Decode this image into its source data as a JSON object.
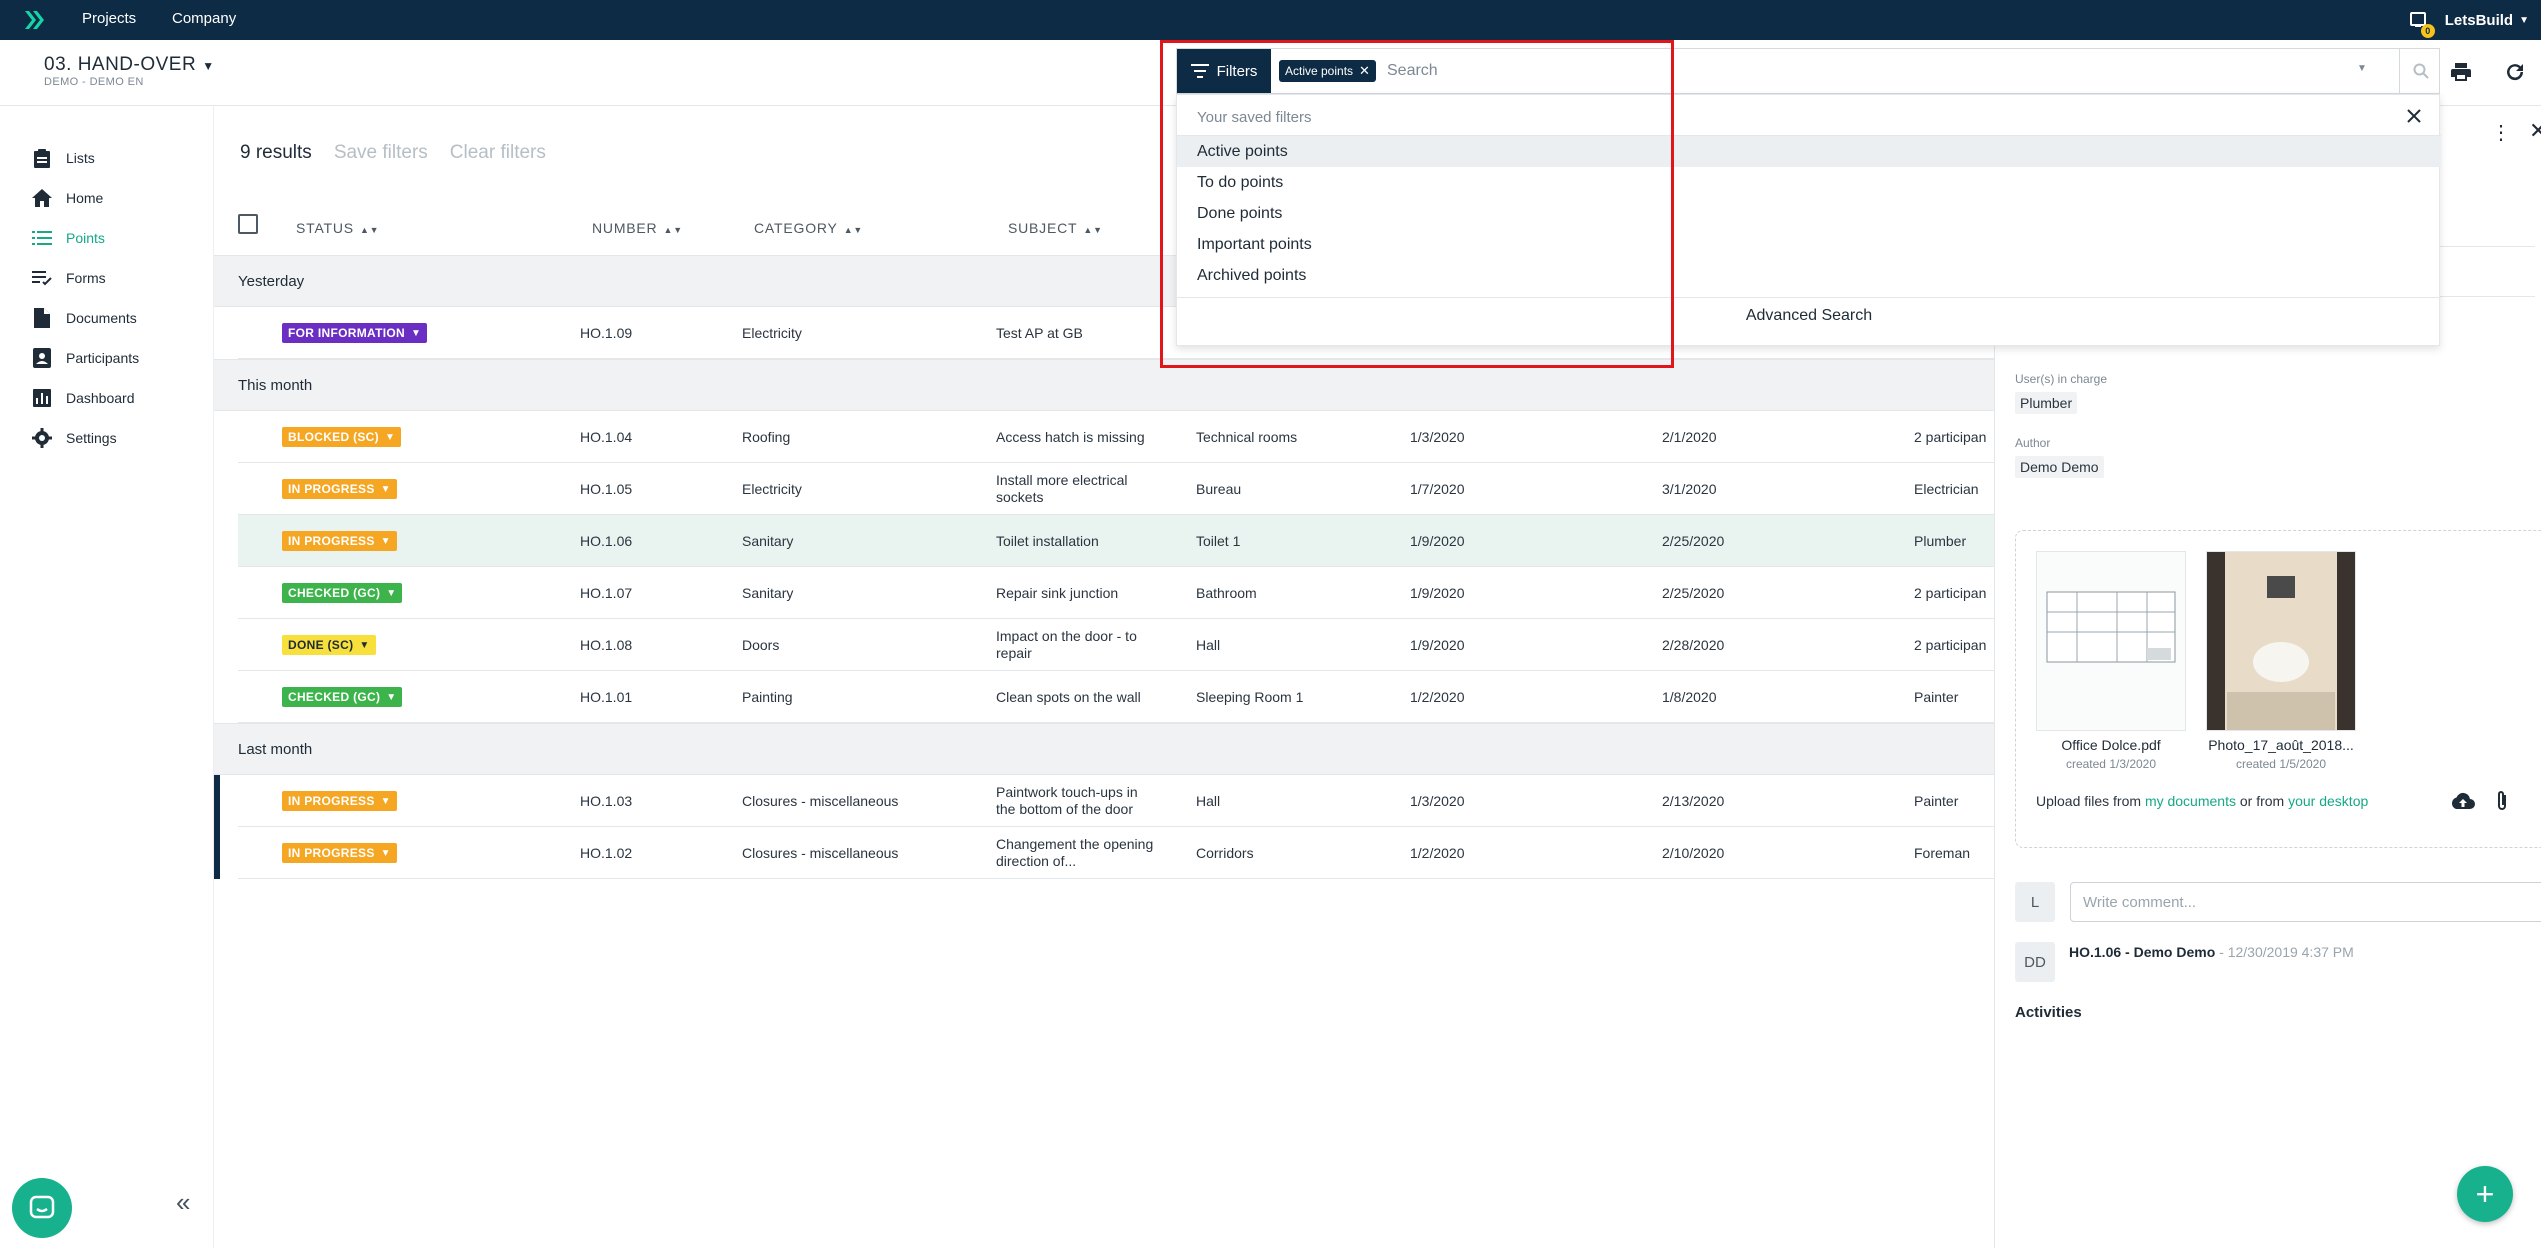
{
  "topbar": {
    "nav": [
      "Projects",
      "Company"
    ],
    "user": "LetsBuild",
    "notification_count": "0"
  },
  "project": {
    "title": "03. HAND-OVER",
    "subtitle": "DEMO - DEMO EN"
  },
  "sidebar": {
    "items": [
      {
        "label": "Lists",
        "icon": "clipboard-icon"
      },
      {
        "label": "Home",
        "icon": "home-icon"
      },
      {
        "label": "Points",
        "icon": "list-icon"
      },
      {
        "label": "Forms",
        "icon": "forms-icon"
      },
      {
        "label": "Documents",
        "icon": "document-icon"
      },
      {
        "label": "Participants",
        "icon": "participants-icon"
      },
      {
        "label": "Dashboard",
        "icon": "dashboard-icon"
      },
      {
        "label": "Settings",
        "icon": "gear-icon"
      }
    ],
    "active": "Points"
  },
  "toolbar": {
    "results": "9 results",
    "save_filters": "Save filters",
    "clear_filters": "Clear filters"
  },
  "table": {
    "headers": [
      "STATUS",
      "NUMBER",
      "CATEGORY",
      "SUBJECT"
    ],
    "groups": [
      {
        "label": "Yesterday",
        "rows": [
          {
            "status": "FOR INFORMATION",
            "color": "#6a2fc2",
            "number": "HO.1.09",
            "category": "Electricity",
            "subject": "Test AP at GB",
            "location": "",
            "created": "",
            "due": "",
            "assignee": ""
          }
        ]
      },
      {
        "label": "This month",
        "rows": [
          {
            "status": "BLOCKED (SC)",
            "color": "#f5a623",
            "number": "HO.1.04",
            "category": "Roofing",
            "subject": "Access hatch is missing",
            "location": "Technical rooms",
            "created": "1/3/2020",
            "due": "2/1/2020",
            "assignee": "2 participan"
          },
          {
            "status": "IN PROGRESS",
            "color": "#f5a623",
            "number": "HO.1.05",
            "category": "Electricity",
            "subject": "Install more electrical sockets",
            "location": "Bureau",
            "created": "1/7/2020",
            "due": "3/1/2020",
            "assignee": "Electrician"
          },
          {
            "status": "IN PROGRESS",
            "color": "#f5a623",
            "number": "HO.1.06",
            "category": "Sanitary",
            "subject": "Toilet installation",
            "location": "Toilet 1",
            "created": "1/9/2020",
            "due": "2/25/2020",
            "assignee": "Plumber",
            "selected": true
          },
          {
            "status": "CHECKED (GC)",
            "color": "#3cb44b",
            "number": "HO.1.07",
            "category": "Sanitary",
            "subject": "Repair sink junction",
            "location": "Bathroom",
            "created": "1/9/2020",
            "due": "2/25/2020",
            "assignee": "2 participan"
          },
          {
            "status": "DONE (SC)",
            "color": "#f7e03c",
            "textColor": "#1f2b36",
            "number": "HO.1.08",
            "category": "Doors",
            "subject": "Impact on the door - to repair",
            "location": "Hall",
            "created": "1/9/2020",
            "due": "2/28/2020",
            "assignee": "2 participan"
          },
          {
            "status": "CHECKED (GC)",
            "color": "#3cb44b",
            "number": "HO.1.01",
            "category": "Painting",
            "subject": "Clean spots on the wall",
            "location": "Sleeping Room 1",
            "created": "1/2/2020",
            "due": "1/8/2020",
            "assignee": "Painter"
          }
        ]
      },
      {
        "label": "Last month",
        "rows": [
          {
            "status": "IN PROGRESS",
            "color": "#f5a623",
            "number": "HO.1.03",
            "category": "Closures - miscellaneous",
            "subject": "Paintwork touch-ups in the bottom of the door",
            "location": "Hall",
            "created": "1/3/2020",
            "due": "2/13/2020",
            "assignee": "Painter",
            "flag": true
          },
          {
            "status": "IN PROGRESS",
            "color": "#f5a623",
            "number": "HO.1.02",
            "category": "Closures - miscellaneous",
            "subject": "Changement the opening direction of...",
            "location": "Corridors",
            "created": "1/2/2020",
            "due": "2/10/2020",
            "assignee": "Foreman",
            "flag": true
          }
        ]
      }
    ]
  },
  "search": {
    "filters_label": "Filters",
    "active_chip": "Active points",
    "placeholder": "Search"
  },
  "dropdown": {
    "header": "Your saved filters",
    "items": [
      "Active points",
      "To do points",
      "Done points",
      "Important points",
      "Archived points"
    ],
    "highlighted": "Active points",
    "advanced": "Advanced Search"
  },
  "detail": {
    "users_label": "User(s) in charge",
    "users_value": "Plumber",
    "author_label": "Author",
    "author_value": "Demo Demo",
    "files": [
      {
        "name": "Office Dolce.pdf",
        "date": "created 1/3/2020"
      },
      {
        "name": "Photo_17_août_2018...",
        "date": "created 1/5/2020"
      }
    ],
    "upload_prefix": "Upload files from",
    "upload_link1": "my documents",
    "upload_mid": "or from",
    "upload_link2": "your desktop",
    "comment_avatar": "L",
    "comment_placeholder": "Write comment...",
    "history_avatar": "DD",
    "history_title": "HO.1.06 - Demo Demo",
    "history_time": "- 12/30/2019 4:37 PM",
    "activities": "Activities"
  },
  "colors": {
    "navy": "#0d2b44",
    "accent": "#16a887",
    "highlight_box": "#e0161b"
  }
}
